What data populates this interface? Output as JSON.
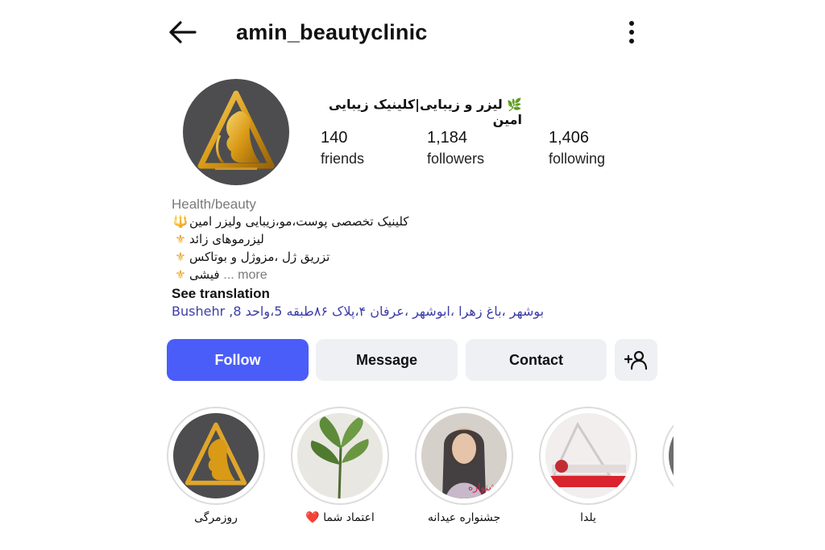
{
  "header": {
    "username": "amin_beautyclinic",
    "back_icon": "arrow-left-icon",
    "more_icon": "vertical-dots-icon"
  },
  "profile": {
    "display_name": "لیزر و زیبایی|کلینیک زیبایی امین",
    "leaf_icon": "🌿",
    "stats": [
      {
        "value": "140",
        "label": "friends"
      },
      {
        "value": "1,184",
        "label": "followers"
      },
      {
        "value": "1,406",
        "label": "following"
      }
    ]
  },
  "bio": {
    "category": "Health/beauty",
    "lines": [
      {
        "icon": "🔱",
        "text": "کلینیک تخصصی پوست،مو،زیبایی ولیزر امین"
      },
      {
        "icon": "⚜",
        "text": "لیزرموهای زائد"
      },
      {
        "icon": "⚜",
        "text": "تزریق ژل ،مزوژل و بوتاکس"
      },
      {
        "icon": "⚜",
        "text": "فیشی"
      }
    ],
    "more_label": "... more",
    "see_translation": "See translation",
    "address": "بوشهر ،باغ زهرا ،ابوشهر ،عرفان ۴،پلاک ۸۶طبقه 5،واحد 8, Bushehr"
  },
  "actions": {
    "follow": "Follow",
    "message": "Message",
    "contact": "Contact",
    "add_user_icon": "person-add-icon"
  },
  "highlights": [
    {
      "caption": "روزمرگی"
    },
    {
      "caption": "اعتماد شما",
      "heart": "❤️"
    },
    {
      "caption": "جشنواره عیدانه"
    },
    {
      "caption": "یلدا"
    }
  ],
  "colors": {
    "follow_bg": "#4a5df9",
    "secondary_bg": "#eef0f3",
    "link": "#3c3ca8",
    "muted": "#7a7a7a"
  }
}
